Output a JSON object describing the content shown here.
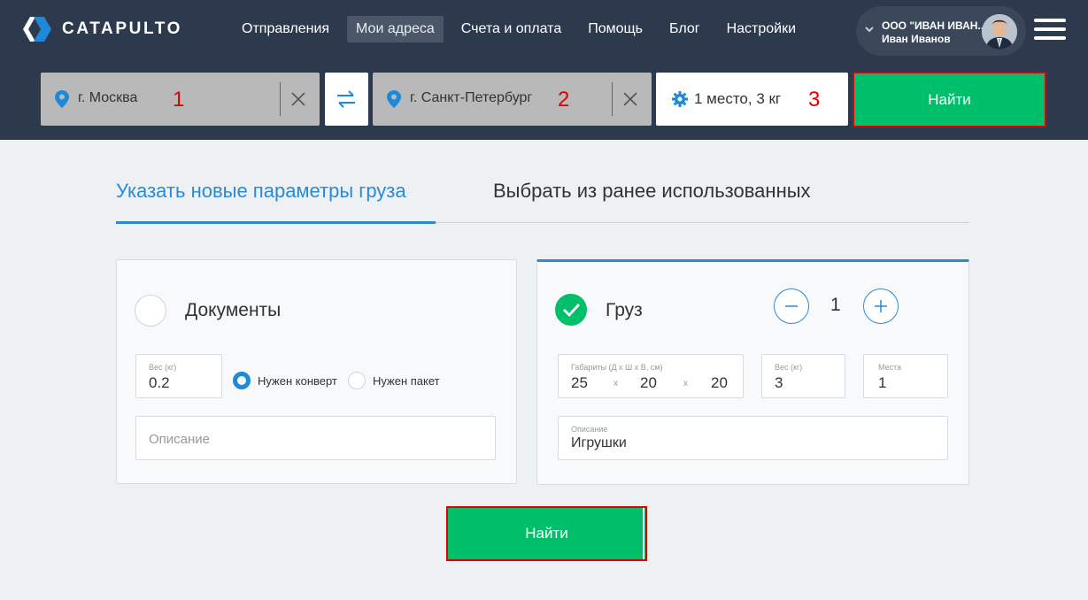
{
  "header": {
    "logo_text": "CATAPULTO",
    "nav": [
      {
        "label": "Отправления",
        "active": false
      },
      {
        "label": "Мои адреса",
        "active": true
      },
      {
        "label": "Счета и оплата",
        "active": false
      },
      {
        "label": "Помощь",
        "active": false
      },
      {
        "label": "Блог",
        "active": false
      },
      {
        "label": "Настройки",
        "active": false
      }
    ],
    "user": {
      "company": "ООО \"ИВАН ИВАН...",
      "name": "Иван Иванов"
    }
  },
  "search": {
    "from": "г. Москва",
    "from_marker": "1",
    "to": "г. Санкт-Петербург",
    "to_marker": "2",
    "params": "1 место, 3 кг",
    "params_marker": "3",
    "find_label": "Найти"
  },
  "tabs": {
    "new_params": "Указать новые параметры груза",
    "previous": "Выбрать из ранее использованных"
  },
  "documents": {
    "title": "Документы",
    "weight_label": "Вес (кг)",
    "weight_value": "0.2",
    "option_envelope": "Нужен конверт",
    "option_package": "Нужен пакет",
    "description_placeholder": "Описание"
  },
  "cargo": {
    "title": "Груз",
    "count": "1",
    "dims_label": "Габариты (Д х Ш х В, см)",
    "dim_l": "25",
    "dim_w": "20",
    "dim_h": "20",
    "dim_sep": "x",
    "weight_label": "Вес (кг)",
    "weight_value": "3",
    "places_label": "Места",
    "places_value": "1",
    "description_label": "Описание",
    "description_value": "Игрушки"
  },
  "bottom": {
    "find_label": "Найти"
  },
  "colors": {
    "header_bg": "#2d3a4d",
    "accent_blue": "#2b8ad2",
    "green": "#00bf6a",
    "highlight_red": "#e00000"
  }
}
